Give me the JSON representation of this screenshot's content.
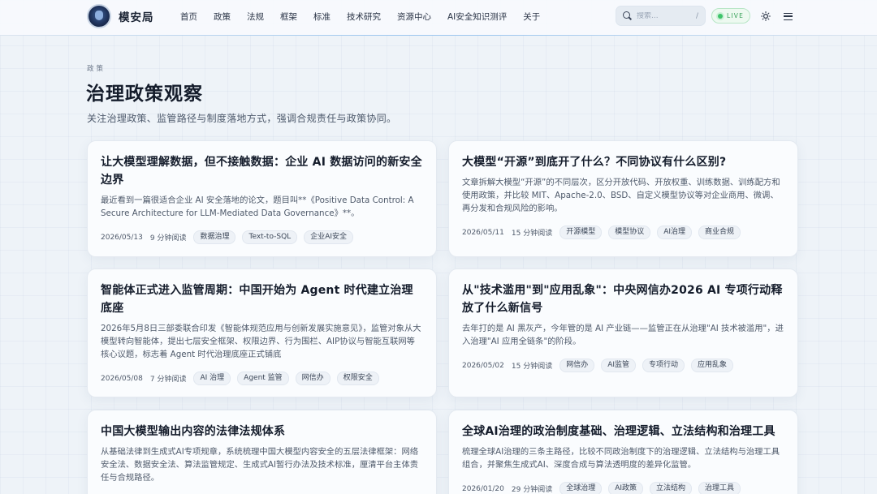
{
  "header": {
    "brand": "模安局",
    "nav": [
      "首页",
      "政策",
      "法规",
      "框架",
      "标准",
      "技术研究",
      "资源中心",
      "AI安全知识测评",
      "关于"
    ],
    "search_placeholder": "搜索...",
    "search_shortcut": "/",
    "live_badge": "LIVE",
    "theme_icon": "sun-icon",
    "menu_icon": "menu-icon"
  },
  "hero": {
    "kicker": "政策",
    "title": "治理政策观察",
    "subtitle": "关注治理政策、监管路径与制度落地方式，强调合规责任与政策协同。"
  },
  "articles": [
    {
      "title": "让大模型理解数据，但不接触数据：企业 AI 数据访问的新安全边界",
      "excerpt": "最近看到一篇很适合企业 AI 安全落地的论文，题目叫**《Positive Data Control: A Secure Architecture for LLM-Mediated Data Governance》**。",
      "date": "2026/05/13",
      "read": "9 分钟阅读",
      "tags": [
        "数据治理",
        "Text-to-SQL",
        "企业AI安全"
      ]
    },
    {
      "title": "大模型“开源”到底开了什么？不同协议有什么区别?",
      "excerpt": "文章拆解大模型“开源”的不同层次，区分开放代码、开放权重、训练数据、训练配方和使用政策，并比较 MIT、Apache-2.0、BSD、自定义模型协议等对企业商用、微调、再分发和合规风险的影响。",
      "date": "2026/05/11",
      "read": "15 分钟阅读",
      "tags": [
        "开源模型",
        "模型协议",
        "AI治理",
        "商业合规"
      ]
    },
    {
      "title": "智能体正式进入监管周期：中国开始为 Agent 时代建立治理底座",
      "excerpt": "2026年5月8日三部委联合印发《智能体规范应用与创新发展实施意见》，监管对象从大模型转向智能体，提出七层安全框架、权限边界、行为围栏、AIP协议与智能互联网等核心议题，标志着 Agent 时代治理底座正式铺底",
      "date": "2026/05/08",
      "read": "7 分钟阅读",
      "tags": [
        "AI 治理",
        "Agent 监管",
        "网信办",
        "权限安全"
      ]
    },
    {
      "title": "从\"技术滥用\"到\"应用乱象\"：中央网信办2026 AI 专项行动释放了什么新信号",
      "excerpt": "去年打的是 AI 黑灰产，今年管的是 AI 产业链——监管正在从治理\"AI 技术被滥用\"，进入治理\"AI 应用全链条\"的阶段。",
      "date": "2026/05/02",
      "read": "15 分钟阅读",
      "tags": [
        "网信办",
        "AI监管",
        "专项行动",
        "应用乱象"
      ]
    },
    {
      "title": "中国大模型输出内容的法律法规体系",
      "excerpt": "从基础法律到生成式AI专项规章，系统梳理中国大模型内容安全的五层法律框架：网络安全法、数据安全法、算法监管规定、生成式AI暂行办法及技术标准，厘清平台主体责任与合规路径。",
      "date": "",
      "read": "",
      "tags": []
    },
    {
      "title": "全球AI治理的政治制度基础、治理逻辑、立法结构和治理工具",
      "excerpt": "梳理全球AI治理的三条主路径，比较不同政治制度下的治理逻辑、立法结构与治理工具组合，并聚焦生成式AI、深度合成与算法透明度的差异化监管。",
      "date": "2026/01/20",
      "read": "29 分钟阅读",
      "tags": [
        "全球治理",
        "AI政策",
        "立法结构",
        "治理工具"
      ]
    }
  ]
}
